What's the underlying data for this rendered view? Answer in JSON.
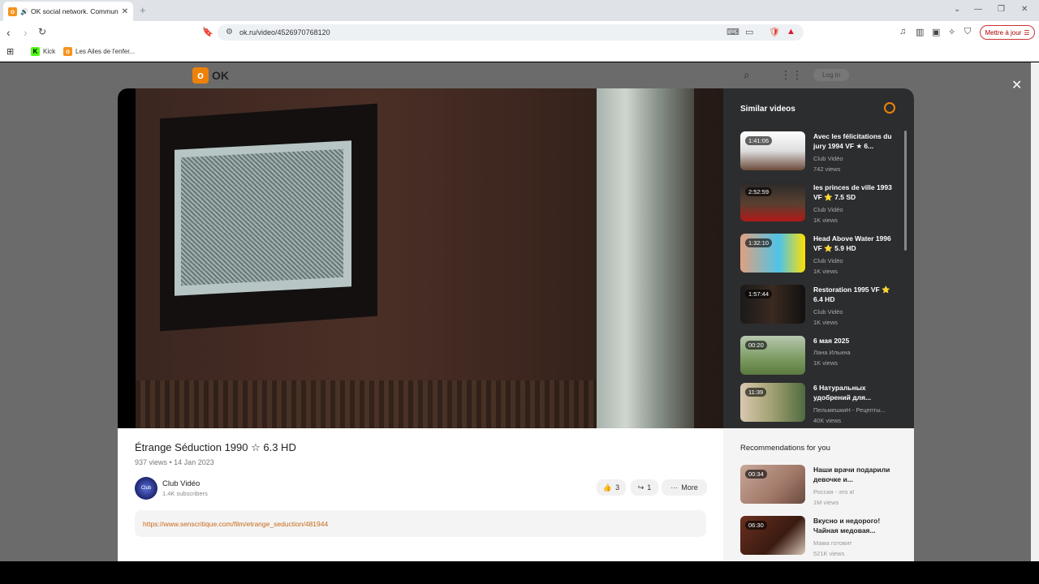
{
  "browser": {
    "tab_title": "OK social network. Communi",
    "url": "ok.ru/video/4526970768120",
    "update_button": "Mettre à jour",
    "bookmarks": [
      {
        "label": "Kick",
        "color": "#53fc18",
        "letter": "K"
      },
      {
        "label": "Les Ailes de l'enfer...",
        "color": "#f7931e",
        "letter": "O"
      }
    ]
  },
  "header": {
    "logo_text": "OK",
    "login_label": "Log in"
  },
  "sidebar": {
    "title": "Similar videos",
    "items": [
      {
        "duration": "1:41:06",
        "title": "Avec les félicitations du jury 1994 VF ★ 6...",
        "channel": "Club Vidéo",
        "views": "742 views"
      },
      {
        "duration": "2:52:59",
        "title": "les princes de ville 1993 VF ⭐ 7.5 SD",
        "channel": "Club Vidéo",
        "views": "1K views"
      },
      {
        "duration": "1:32:10",
        "title": "Head Above Water 1996 VF ⭐ 5.9 HD",
        "channel": "Club Vidéo",
        "views": "1K views"
      },
      {
        "duration": "1:57:44",
        "title": "Restoration 1995 VF ⭐ 6.4 HD",
        "channel": "Club Vidéo",
        "views": "1K views"
      },
      {
        "duration": "00:20",
        "title": "6 мая 2025",
        "channel": "Лана Ильина",
        "views": "1K views"
      },
      {
        "duration": "11:39",
        "title": "6 Натуральных удобрений для...",
        "channel": "ПельмешкиН - Рецепты...",
        "views": "40K views"
      }
    ]
  },
  "video": {
    "title": "Étrange Séduction 1990 ☆ 6.3 HD",
    "meta": "937 views • 14 Jan 2023",
    "channel": "Club Vidéo",
    "subscribers": "1.4K subscribers",
    "likes": "3",
    "shares": "1",
    "more_label": "More",
    "link": "https://www.senscritique.com/film/etrange_seduction/481944"
  },
  "recommendations": {
    "title": "Recommendations for you",
    "items": [
      {
        "duration": "00:34",
        "title": "Наши врачи подарили девочке и...",
        "channel": "Россия - это я!",
        "views": "1M views"
      },
      {
        "duration": "06:30",
        "title": "Вкусно и недорого! Чайная медовая...",
        "channel": "Мама готовит",
        "views": "521K views"
      }
    ]
  }
}
